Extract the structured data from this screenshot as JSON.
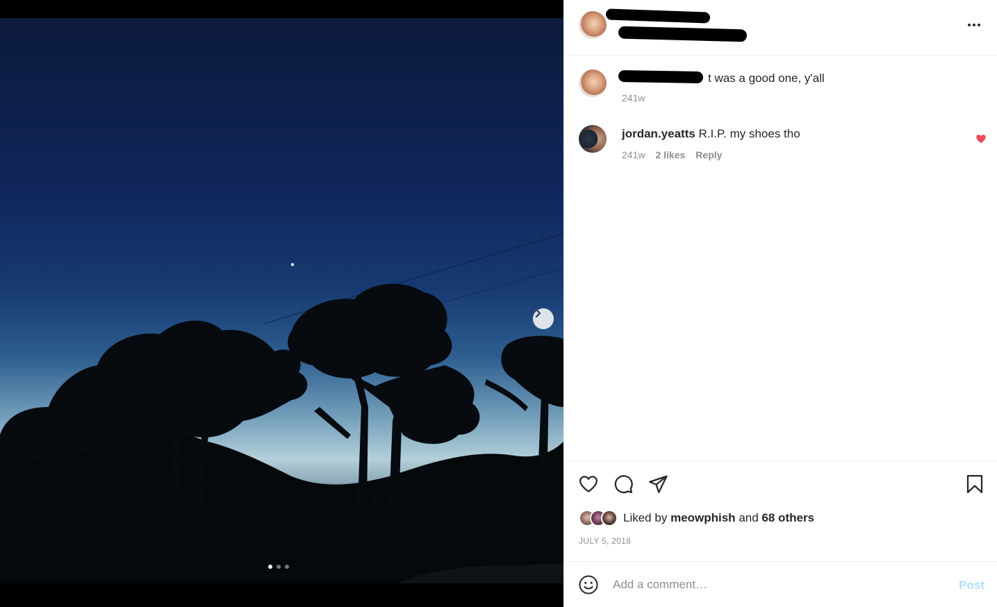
{
  "post": {
    "media": {
      "carousel_count": 3,
      "active_index": 0
    },
    "caption": {
      "text": "t was a good one, y'all",
      "time": "241w"
    },
    "comments": [
      {
        "username": "jordan.yeatts",
        "text": "R.I.P. my shoes tho",
        "time": "241w",
        "likes": "2 likes",
        "reply_label": "Reply",
        "liked": true
      }
    ],
    "likes": {
      "prefix": "Liked by",
      "first_user": "meowphish",
      "joiner": "and",
      "others": "68 others"
    },
    "date": "JULY 5, 2018"
  },
  "composer": {
    "placeholder": "Add a comment…",
    "post_label": "Post"
  },
  "colors": {
    "accent_disabled": "#b2dffc",
    "like_red": "#ed4956",
    "muted_text": "#8e8e8e",
    "divider": "#efefef"
  },
  "icons": {
    "like": "heart-icon",
    "comment": "comment-bubble-icon",
    "share": "paper-plane-icon",
    "save": "bookmark-icon",
    "more": "ellipsis-icon",
    "emoji": "emoji-smile-icon",
    "next": "chevron-right-icon"
  }
}
